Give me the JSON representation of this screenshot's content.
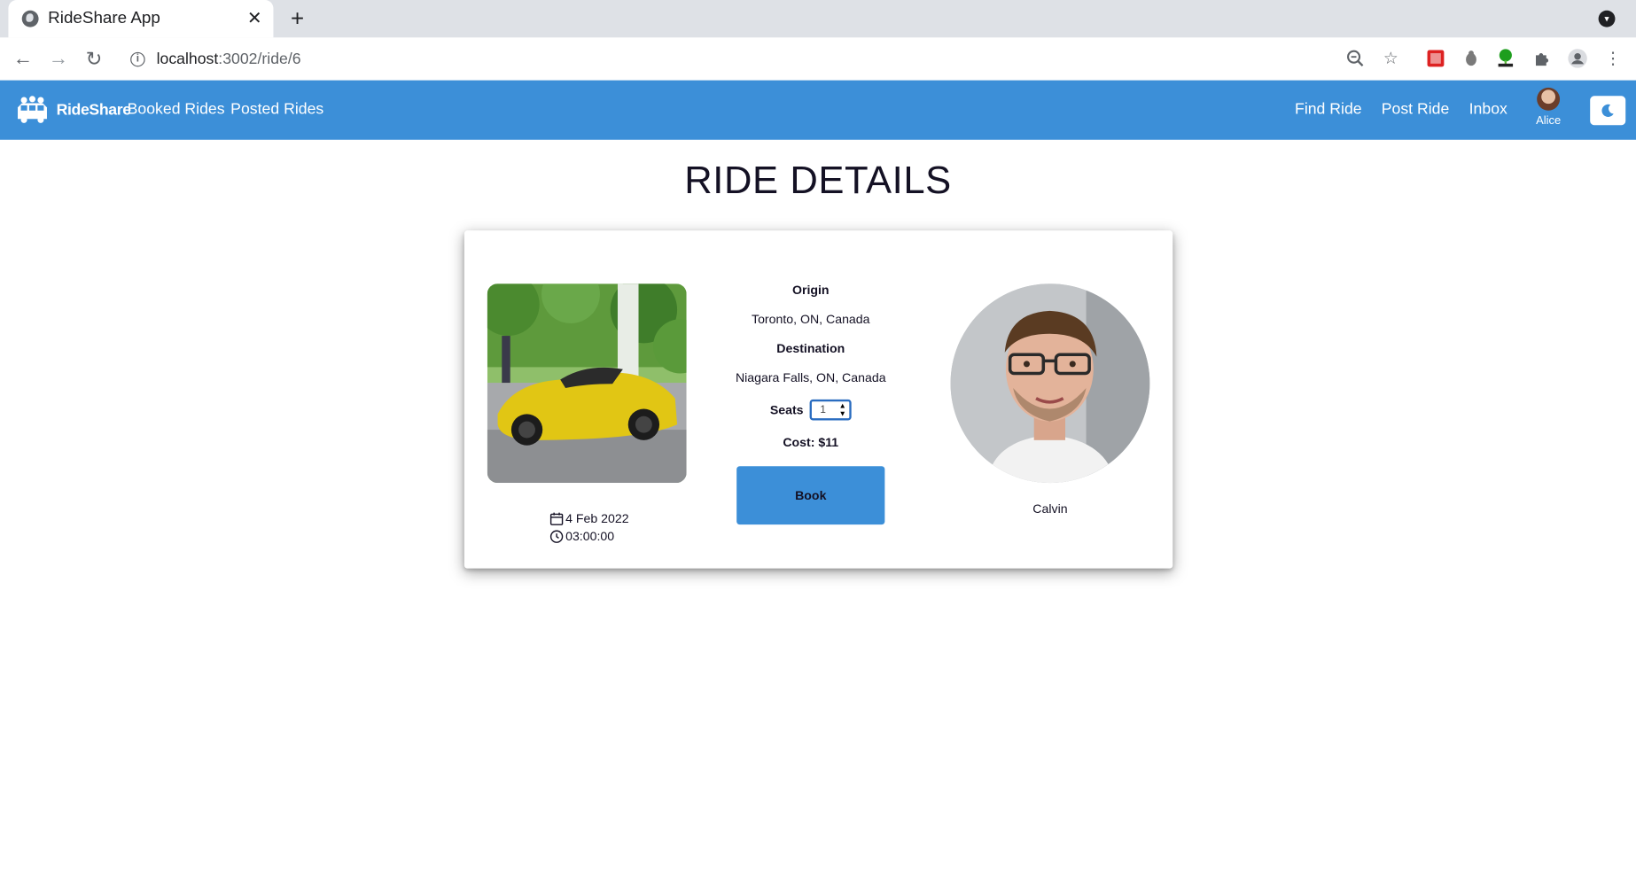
{
  "browser": {
    "tab_title": "RideShare App",
    "url_host": "localhost",
    "url_path": ":3002/ride/6"
  },
  "navbar": {
    "brand": "RideShare",
    "links_left": [
      "Booked Rides",
      "Posted Rides"
    ],
    "links_right": [
      "Find Ride",
      "Post Ride",
      "Inbox"
    ],
    "user_name": "Alice",
    "accent_color": "#3c8fd8"
  },
  "page": {
    "title": "RIDE DETAILS"
  },
  "ride": {
    "date": "4 Feb 2022",
    "time": "03:00:00",
    "origin_label": "Origin",
    "origin": "Toronto, ON, Canada",
    "destination_label": "Destination",
    "destination": "Niagara Falls, ON, Canada",
    "seats_label": "Seats",
    "seats_value": "1",
    "cost": "Cost: $11",
    "book_label": "Book",
    "driver_name": "Calvin"
  }
}
